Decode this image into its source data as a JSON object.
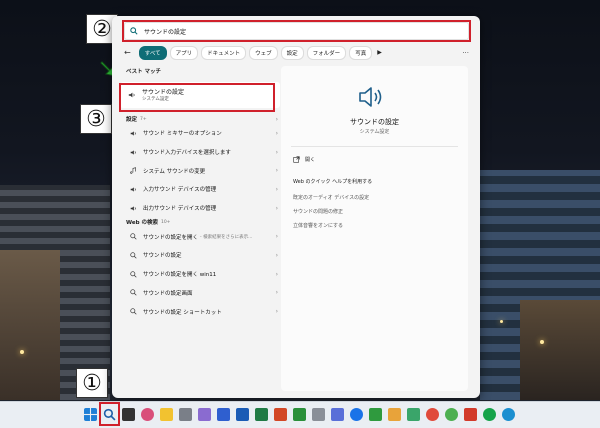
{
  "search": {
    "query": "サウンドの設定"
  },
  "tabs": [
    "すべて",
    "アプリ",
    "ドキュメント",
    "ウェブ",
    "設定",
    "フォルダー",
    "写真"
  ],
  "best_match": {
    "header": "ベスト マッチ",
    "title": "サウンドの設定",
    "subtitle": "システム設定"
  },
  "settings_section": {
    "header": "設定",
    "count": "7+"
  },
  "settings_items": [
    "サウンド ミキサーのオプション",
    "サウンド入力デバイスを選択します",
    "システム サウンドの変更",
    "入力サウンド デバイスの管理",
    "出力サウンド デバイスの管理"
  ],
  "web_section": {
    "header": "Web の検索",
    "count": "10+"
  },
  "web_items": [
    {
      "text": "サウンドの設定を開く",
      "suffix": "- 検索結果をさらに表示..."
    },
    {
      "text": "サウンドの設定",
      "suffix": ""
    },
    {
      "text": "サウンドの設定を開く win11",
      "suffix": ""
    },
    {
      "text": "サウンドの設定画面",
      "suffix": ""
    },
    {
      "text": "サウンドの設定 ショートカット",
      "suffix": ""
    }
  ],
  "preview": {
    "title": "サウンドの設定",
    "subtitle": "システム設定",
    "actions": [
      "開く",
      "Web のクイック ヘルプを利用する",
      "既定のオーディオ デバイスの設定",
      "サウンドの問題の修正",
      "立体音響をオンにする"
    ]
  },
  "annotations": {
    "one": "①",
    "two": "②",
    "three": "③"
  },
  "colors": {
    "accent": "#0f6d76",
    "highlight": "#d0202b",
    "arrow": "#2fbf3a"
  }
}
